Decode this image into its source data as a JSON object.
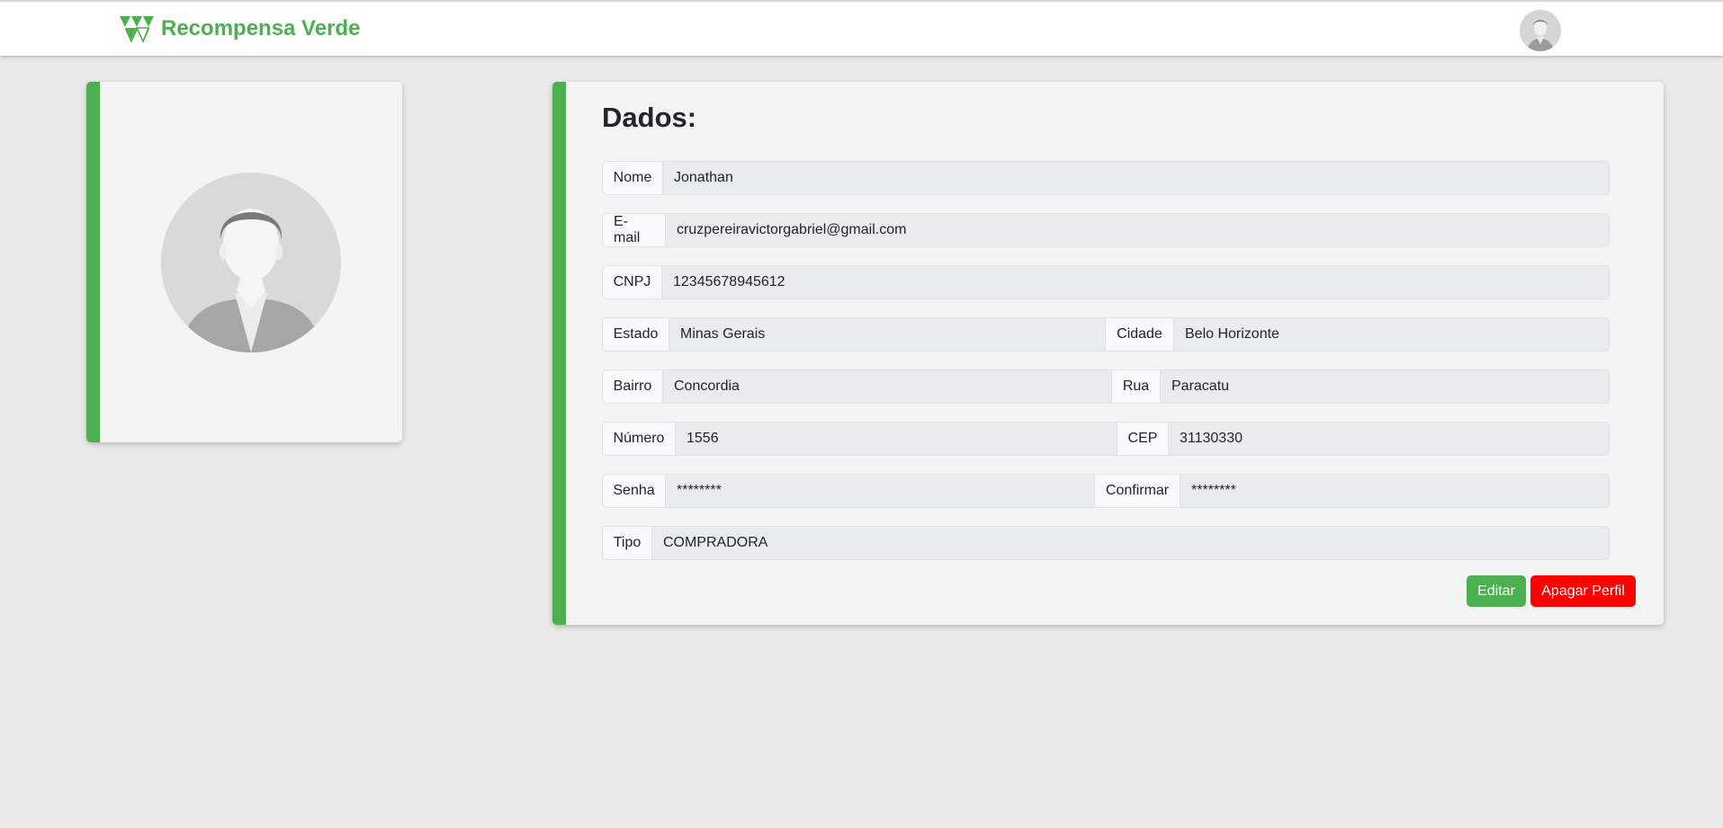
{
  "header": {
    "brand_name": "Recompensa Verde",
    "brand_color": "#4caf50",
    "logo_icon": "triangles-logo-icon",
    "user_avatar_icon": "user-avatar-icon"
  },
  "profile_card": {
    "photo_icon": "profile-photo-placeholder"
  },
  "data_card": {
    "title": "Dados:",
    "fields": {
      "nome": {
        "label": "Nome",
        "value": "Jonathan"
      },
      "email": {
        "label": "E-mail",
        "value": "cruzpereiravictorgabriel@gmail.com"
      },
      "cnpj": {
        "label": "CNPJ",
        "value": "12345678945612"
      },
      "estado": {
        "label": "Estado",
        "value": "Minas Gerais"
      },
      "cidade": {
        "label": "Cidade",
        "value": "Belo Horizonte"
      },
      "bairro": {
        "label": "Bairro",
        "value": "Concordia"
      },
      "rua": {
        "label": "Rua",
        "value": "Paracatu"
      },
      "numero": {
        "label": "Número",
        "value": "1556"
      },
      "cep": {
        "label": "CEP",
        "value": "31130330"
      },
      "senha": {
        "label": "Senha",
        "value": "********"
      },
      "confirmar": {
        "label": "Confirmar",
        "value": "********"
      },
      "tipo": {
        "label": "Tipo",
        "value": "COMPRADORA"
      }
    },
    "buttons": {
      "edit_label": "Editar",
      "delete_label": "Apagar Perfil"
    }
  },
  "colors": {
    "accent": "#4caf50",
    "danger": "#ff0000",
    "background": "#e9e9e9",
    "card": "#f4f4f4"
  }
}
